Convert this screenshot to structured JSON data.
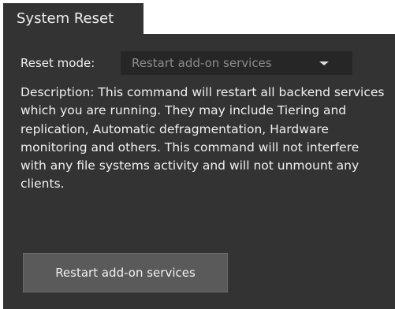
{
  "tab": {
    "title": "System Reset"
  },
  "reset_mode": {
    "label": "Reset mode:",
    "selected": "Restart add-on services"
  },
  "description": {
    "text": "Description:   This command will restart all backend services which you are running. They may include Tiering and replication, Automatic defragmentation, Hardware monitoring and others. This command will not interfere with any file systems activity and will not unmount any clients."
  },
  "actions": {
    "restart_label": "Restart add-on services"
  },
  "colors": {
    "panel_bg": "#333333",
    "select_bg": "#262626",
    "button_bg": "#5a5a5a",
    "text": "#f0f0f0",
    "muted_text": "#8c8c8c"
  }
}
